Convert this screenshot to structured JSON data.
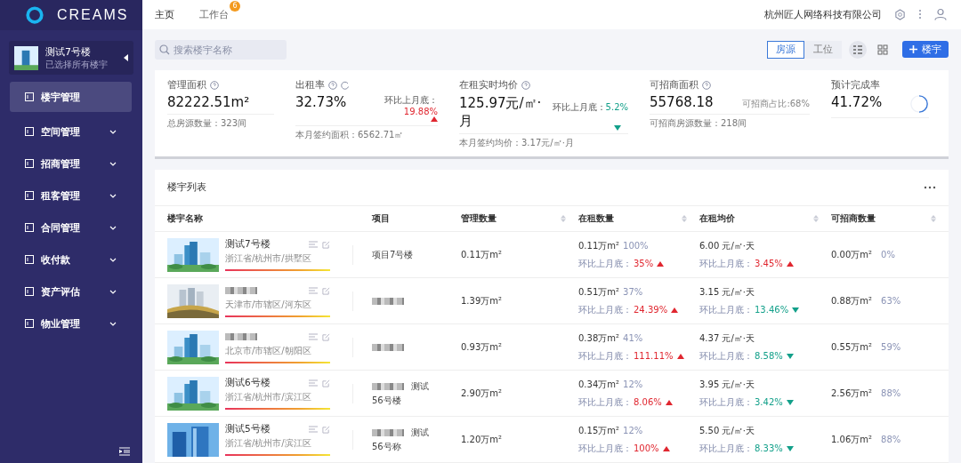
{
  "sidebar": {
    "logo": "CREAMS",
    "building": {
      "name": "测试7号楼",
      "subtitle": "已选择所有楼宇"
    },
    "items": [
      {
        "label": "楼宇管理",
        "selected": true,
        "expandable": false
      },
      {
        "label": "空间管理",
        "selected": false,
        "expandable": true
      },
      {
        "label": "招商管理",
        "selected": false,
        "expandable": true
      },
      {
        "label": "租客管理",
        "selected": false,
        "expandable": true
      },
      {
        "label": "合同管理",
        "selected": false,
        "expandable": true
      },
      {
        "label": "收付款",
        "selected": false,
        "expandable": true
      },
      {
        "label": "资产评估",
        "selected": false,
        "expandable": true
      },
      {
        "label": "物业管理",
        "selected": false,
        "expandable": true
      }
    ]
  },
  "topbar": {
    "tabs": [
      {
        "label": "主页",
        "selected": true
      },
      {
        "label": "工作台",
        "selected": false,
        "badge": "6"
      }
    ],
    "company": "杭州匠人网络科技有限公司"
  },
  "search": {
    "placeholder": "搜索楼宇名称"
  },
  "toggle": [
    {
      "label": "房源",
      "selected": true
    },
    {
      "label": "工位",
      "selected": false
    }
  ],
  "view": {
    "list_selected": true
  },
  "add_button": "楼宇",
  "stats": [
    {
      "label": "管理面积",
      "help": true,
      "value": "82222.51m²",
      "footer": "总房源数量：323间"
    },
    {
      "label": "出租率",
      "help": true,
      "refresh": true,
      "value": "32.73%",
      "compare": {
        "label": "环比上月底：",
        "value": "19.88%",
        "rising": true
      },
      "footer": "本月签约面积：6562.71㎡"
    },
    {
      "label": "在租实时均价",
      "help": true,
      "value": "125.97元/㎡·月",
      "compare": {
        "label": "环比上月底：",
        "value": "5.2%",
        "rising": false
      },
      "footer": "本月签约均价：3.17元/㎡·月"
    },
    {
      "label": "可招商面积",
      "help": true,
      "value": "55768.18",
      "side": "可招商占比:68%",
      "footer": "可招商房源数量：218间"
    },
    {
      "label": "预计完成率",
      "value": "41.72%",
      "spinner": true
    }
  ],
  "table": {
    "title": "楼宇列表",
    "columns": [
      {
        "label": "楼宇名称",
        "sortable": false
      },
      {
        "label": "项目",
        "sortable": false
      },
      {
        "label": "管理数量",
        "sortable": true
      },
      {
        "label": "在租数量",
        "sortable": true
      },
      {
        "label": "在租均价",
        "sortable": true
      },
      {
        "label": "可招商数量",
        "sortable": true
      }
    ],
    "rows": [
      {
        "name": "测试7号楼",
        "address": "浙江省/杭州市/拱墅区",
        "project": "项目7号楼",
        "managed": "0.11万m²",
        "rented": "0.11万m²",
        "rented_pct": "100%",
        "rented_trend": {
          "label": "环比上月底：",
          "value": "35%",
          "rising": true
        },
        "price": "6.00 元/㎡·天",
        "price_trend": {
          "label": "环比上月底：",
          "value": "3.45%",
          "rising": true
        },
        "available": "0.00万m²",
        "available_pct": "0%"
      },
      {
        "name_redacted": true,
        "address": "天津市/市辖区/河东区",
        "project_redacted": true,
        "managed": "1.39万m²",
        "rented": "0.51万m²",
        "rented_pct": "37%",
        "rented_trend": {
          "label": "环比上月底：",
          "value": "24.39%",
          "rising": true
        },
        "price": "3.15 元/㎡·天",
        "price_trend": {
          "label": "环比上月底：",
          "value": "13.46%",
          "rising": false
        },
        "available": "0.88万m²",
        "available_pct": "63%"
      },
      {
        "name_redacted": true,
        "address": "北京市/市辖区/朝阳区",
        "project_redacted": true,
        "managed": "0.93万m²",
        "rented": "0.38万m²",
        "rented_pct": "41%",
        "rented_trend": {
          "label": "环比上月底：",
          "value": "111.11%",
          "rising": true
        },
        "price": "4.37 元/㎡·天",
        "price_trend": {
          "label": "环比上月底：",
          "value": "8.58%",
          "rising": false
        },
        "available": "0.55万m²",
        "available_pct": "59%"
      },
      {
        "name": "测试6号楼",
        "address": "浙江省/杭州市/滨江区",
        "project_redacted": true,
        "project_tail": "测试",
        "project_line2": "56号楼",
        "managed": "2.90万m²",
        "rented": "0.34万m²",
        "rented_pct": "12%",
        "rented_trend": {
          "label": "环比上月底：",
          "value": "8.06%",
          "rising": true
        },
        "price": "3.95 元/㎡·天",
        "price_trend": {
          "label": "环比上月底：",
          "value": "3.42%",
          "rising": false
        },
        "available": "2.56万m²",
        "available_pct": "88%"
      },
      {
        "name": "测试5号楼",
        "address": "浙江省/杭州市/滨江区",
        "project_redacted": true,
        "project_tail": "测试",
        "project_line2": "56号称",
        "managed": "1.20万m²",
        "rented": "0.15万m²",
        "rented_pct": "12%",
        "rented_trend": {
          "label": "环比上月底：",
          "value": "100%",
          "rising": true
        },
        "price": "5.50 元/㎡·天",
        "price_trend": {
          "label": "环比上月底：",
          "value": "8.33%",
          "rising": false
        },
        "available": "1.06万m²",
        "available_pct": "88%"
      }
    ]
  }
}
